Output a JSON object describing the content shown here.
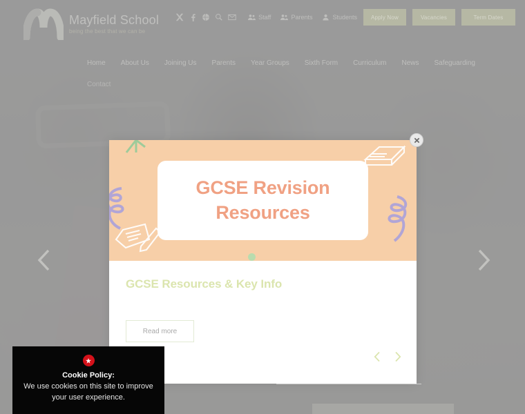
{
  "site": {
    "logo": {
      "name": "Mayfield School",
      "tagline": "being the best that we can be",
      "icon": "mayfield-m-ribbon-logo"
    }
  },
  "topbar": {
    "social": [
      {
        "name": "x-twitter-icon",
        "label": "X"
      },
      {
        "name": "facebook-icon",
        "label": "Facebook"
      },
      {
        "name": "globe-icon",
        "label": "Website"
      },
      {
        "name": "search-icon",
        "label": "Search"
      },
      {
        "name": "envelope-icon",
        "label": "Email"
      }
    ],
    "links": [
      {
        "label": "Staff",
        "icon": "users-icon"
      },
      {
        "label": "Parents",
        "icon": "users-icon"
      },
      {
        "label": "Students",
        "icon": "user-icon"
      }
    ],
    "buttons": [
      {
        "label": "Apply Now"
      },
      {
        "label": "Vacancies"
      },
      {
        "label": "Term Dates"
      }
    ]
  },
  "nav": {
    "items": [
      {
        "label": "Home"
      },
      {
        "label": "About Us"
      },
      {
        "label": "Joining Us"
      },
      {
        "label": "Parents"
      },
      {
        "label": "Year Groups"
      },
      {
        "label": "Sixth Form"
      },
      {
        "label": "Curriculum"
      },
      {
        "label": "News"
      },
      {
        "label": "Safeguarding"
      }
    ],
    "contact": "Contact"
  },
  "carousel": {
    "prev_icon": "chevron-left-icon",
    "next_icon": "chevron-right-icon"
  },
  "modal": {
    "close_icon": "close-icon",
    "banner": {
      "line1": "GCSE Revision",
      "line2": "Resources",
      "background_color": "#f7cfa8",
      "text_color": "#f0a183",
      "decorations": [
        "books-icon",
        "notepad-pencil-icon",
        "squiggle-icon",
        "leaf-icon",
        "dot-icon"
      ]
    },
    "heading": "GCSE Resources & Key Info",
    "heading_color": "#dbe5ae",
    "read_more": "Read more",
    "slider": {
      "prev_icon": "chevron-left-icon",
      "next_icon": "chevron-right-icon"
    }
  },
  "cookie": {
    "icon": "cookie-alert-icon",
    "title": "Cookie Policy:",
    "text": "We use cookies on this site to improve your user experience."
  }
}
